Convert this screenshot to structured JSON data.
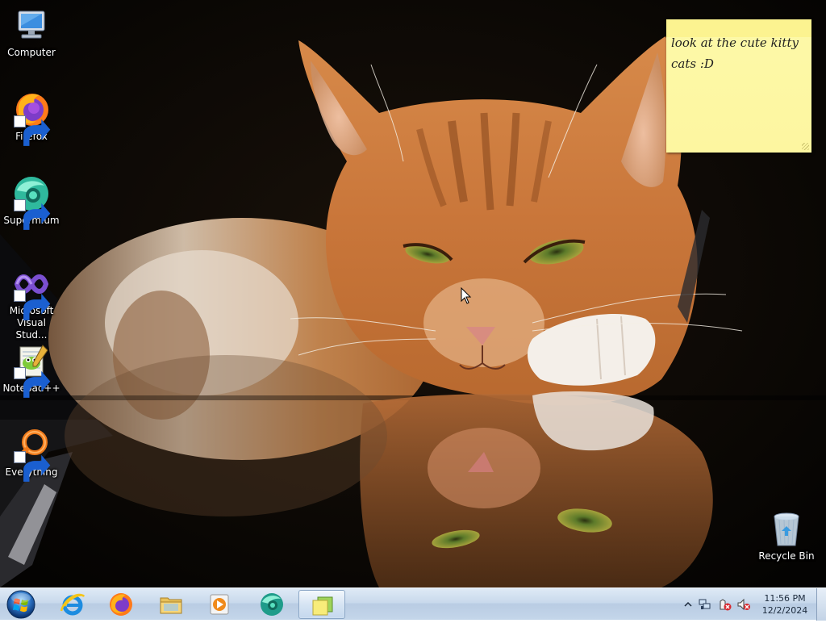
{
  "desktop": {
    "icons": [
      {
        "label": "Computer",
        "icon": "computer-icon",
        "shortcut": false
      },
      {
        "label": "Firefox",
        "icon": "firefox-icon",
        "shortcut": true
      },
      {
        "label": "Supermium",
        "icon": "supermium-icon",
        "shortcut": true
      },
      {
        "label": "Microsoft Visual Stud...",
        "icon": "visual-studio-icon",
        "shortcut": true
      },
      {
        "label": "Notepad++",
        "icon": "notepadpp-icon",
        "shortcut": true
      },
      {
        "label": "Everything",
        "icon": "everything-icon",
        "shortcut": true
      }
    ],
    "recycle_bin": {
      "label": "Recycle Bin",
      "icon": "recycle-bin-icon"
    }
  },
  "sticky_note": {
    "text": "look at the cute kitty cats :D",
    "color": "#fdf7a4"
  },
  "taskbar": {
    "start_icon": "windows-start-icon",
    "pinned": [
      {
        "name": "internet-explorer",
        "icon": "internet-explorer-icon",
        "active": false
      },
      {
        "name": "firefox",
        "icon": "firefox-icon",
        "active": false
      },
      {
        "name": "file-explorer",
        "icon": "folder-icon",
        "active": false
      },
      {
        "name": "media-player",
        "icon": "media-player-icon",
        "active": false
      },
      {
        "name": "supermium",
        "icon": "supermium-icon",
        "active": false
      },
      {
        "name": "sticky-notes",
        "icon": "sticky-notes-icon",
        "active": true
      }
    ],
    "tray": {
      "icons": [
        "show-hidden-icons-chevron",
        "network-icon",
        "action-center-icon",
        "volume-muted-icon"
      ],
      "time": "11:56 PM",
      "date": "12/2/2024"
    }
  },
  "colors": {
    "taskbar": "#c9d9ec",
    "wallpaper_dark": "#070503",
    "cat_orange": "#c87a3c"
  }
}
